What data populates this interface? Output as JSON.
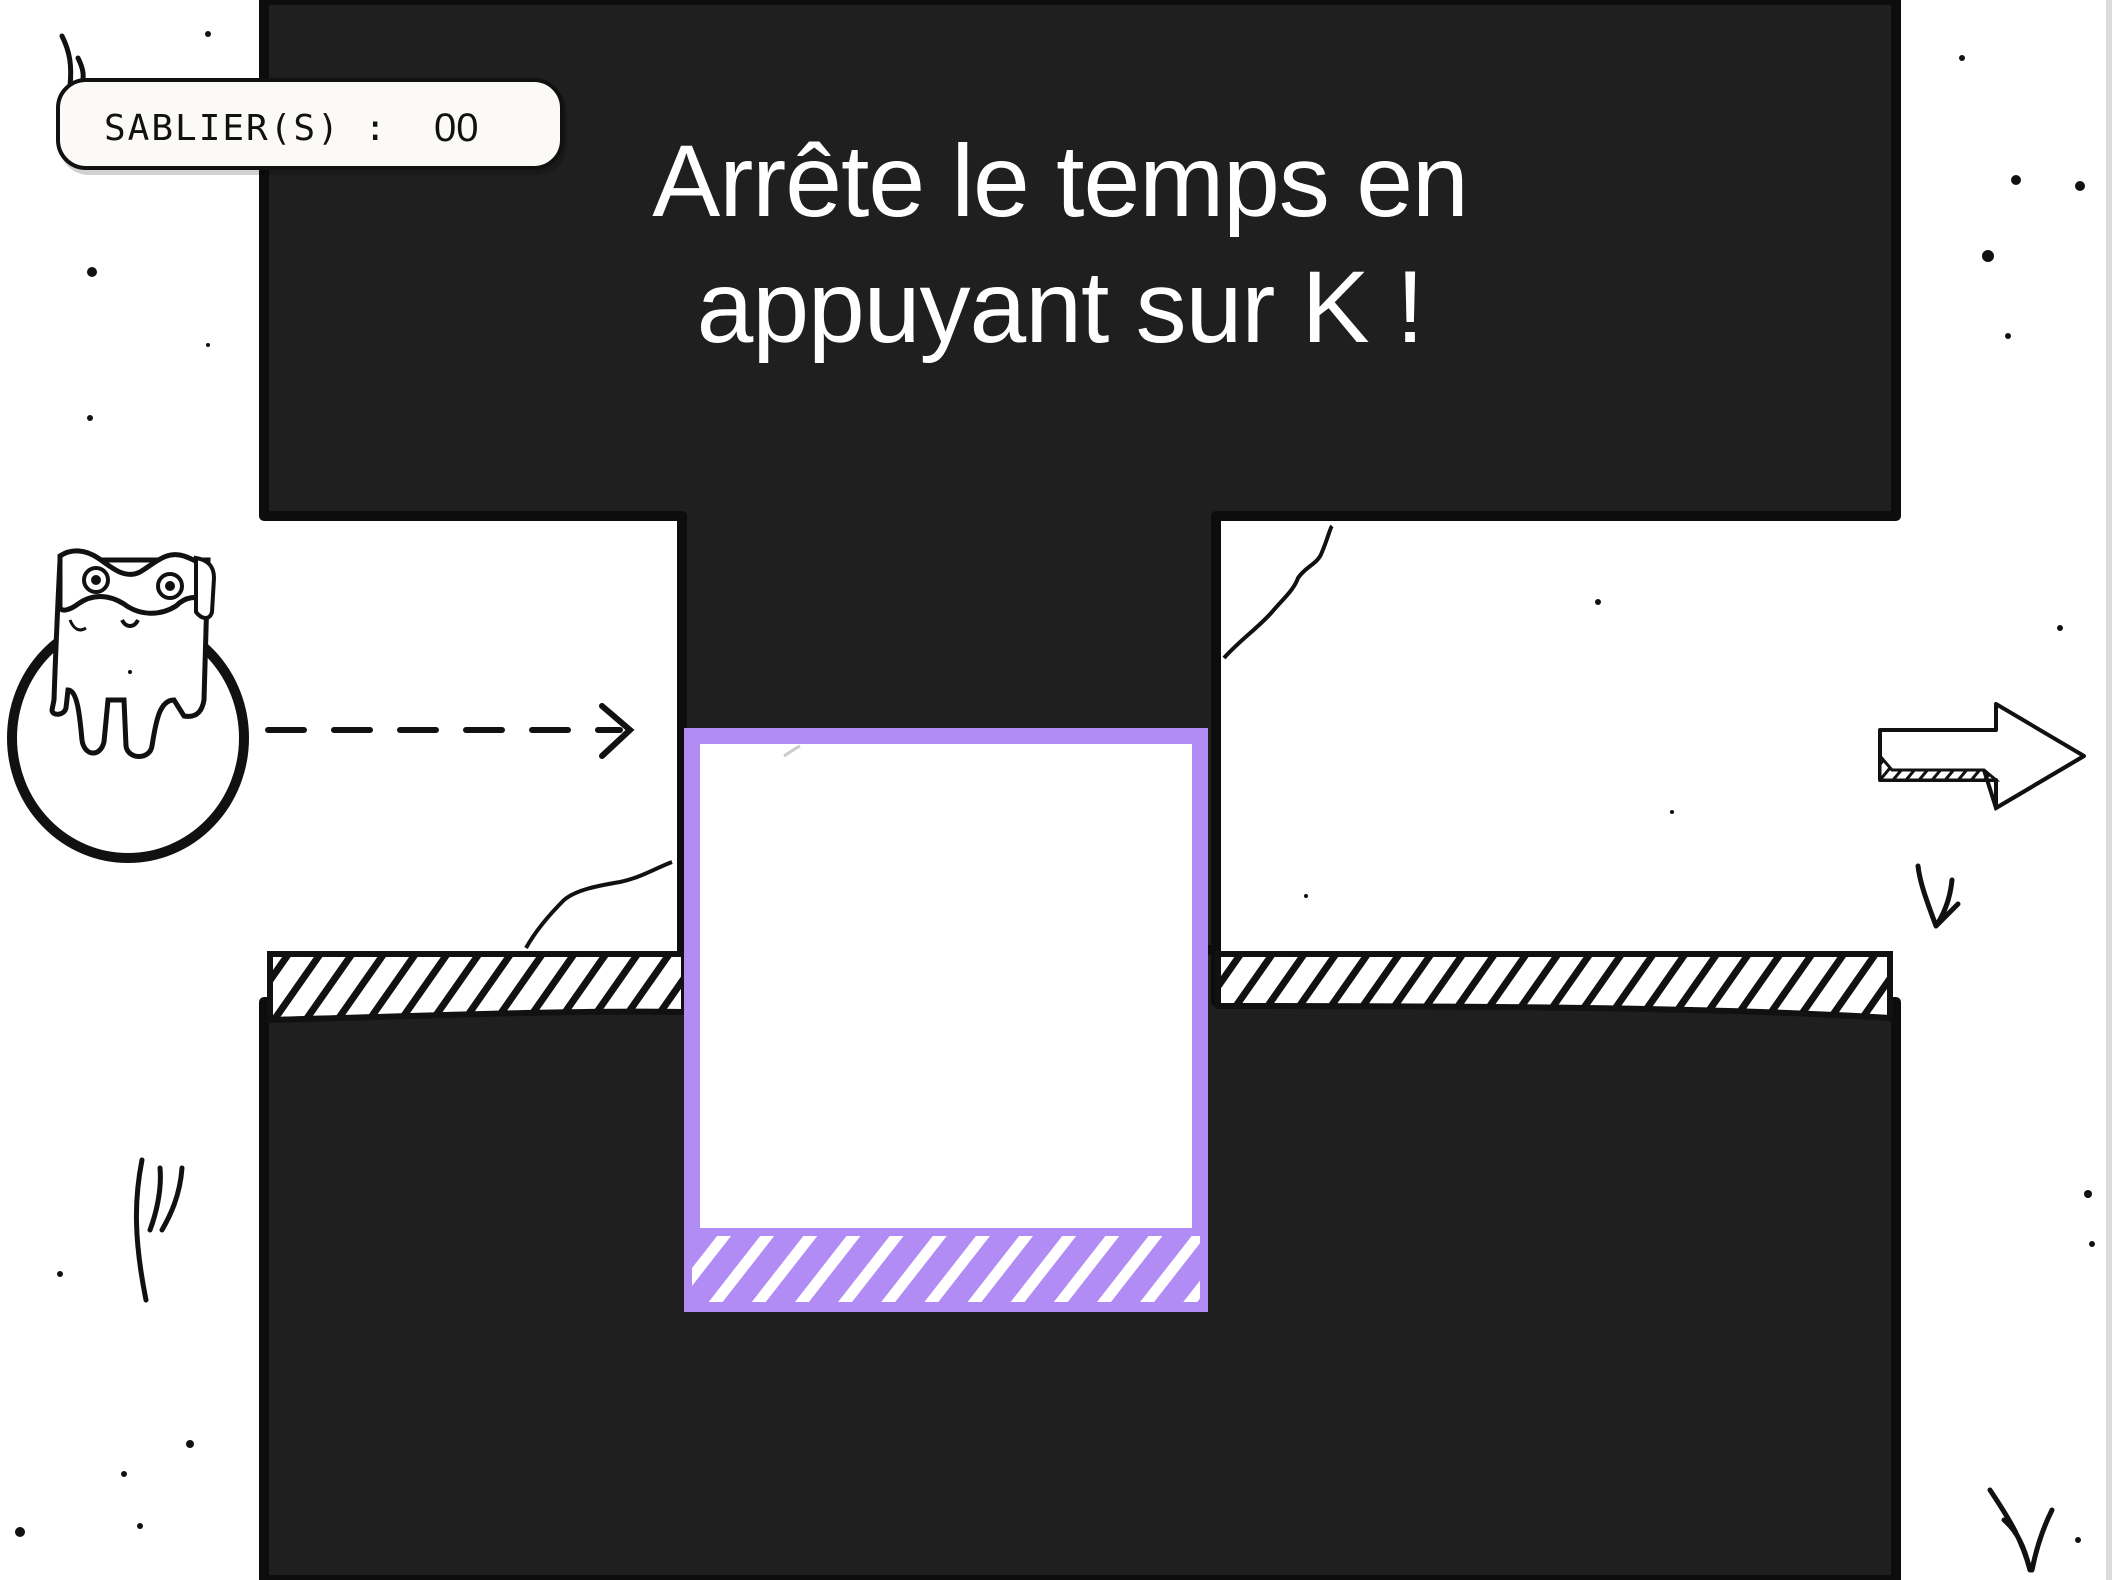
{
  "hud": {
    "label": "SABLIER(S) :",
    "count": "00"
  },
  "instruction": {
    "line1": "Arrête le temps en",
    "line2": "appuyant sur K !"
  },
  "colors": {
    "background": "#ffffff",
    "wall": "#1f1f1f",
    "ink": "#111111",
    "time_block": "#b28cf5",
    "hud_fill": "#fbfaf6"
  },
  "icons": {
    "player": "hourglass-character-icon",
    "exit": "right-arrow-icon",
    "path_hint": "dashed-arrow-icon"
  }
}
